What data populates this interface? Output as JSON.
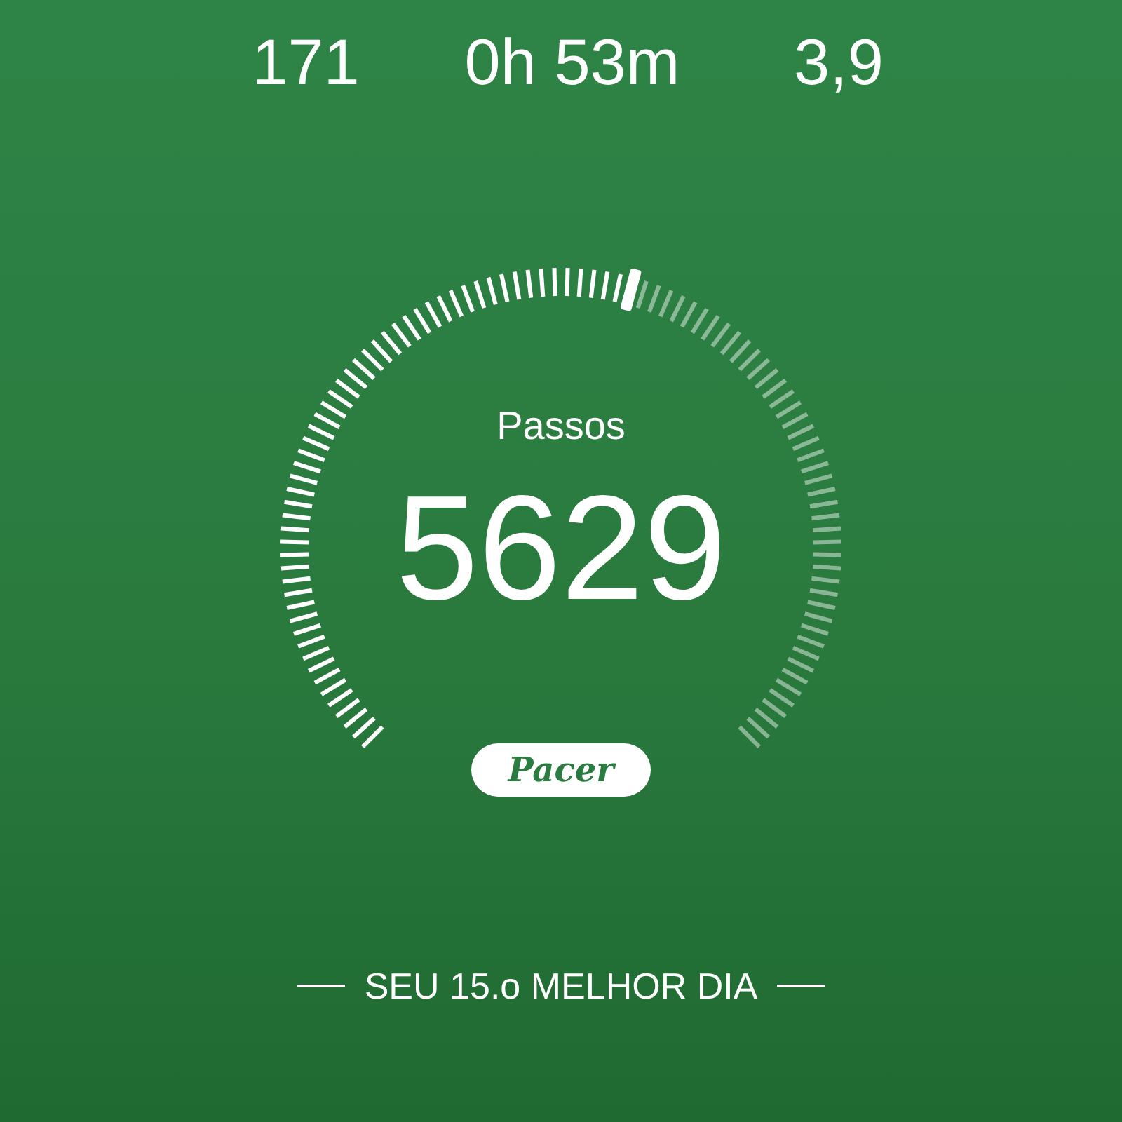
{
  "stats": [
    {
      "value": "171"
    },
    {
      "value": "0h 53m"
    },
    {
      "value": "3,9"
    }
  ],
  "gauge": {
    "label": "Passos",
    "value": "5629"
  },
  "badge": {
    "text": "Pacer"
  },
  "footer": {
    "text": "SEU 15.o MELHOR DIA"
  }
}
